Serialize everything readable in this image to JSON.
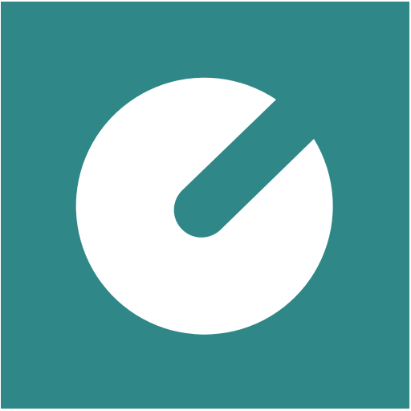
{
  "colors": {
    "background": "#2f8787",
    "mark": "#ffffff",
    "outer": "#ffffff"
  },
  "logo": {
    "icon": "circle-with-diagonal-slot-icon"
  }
}
